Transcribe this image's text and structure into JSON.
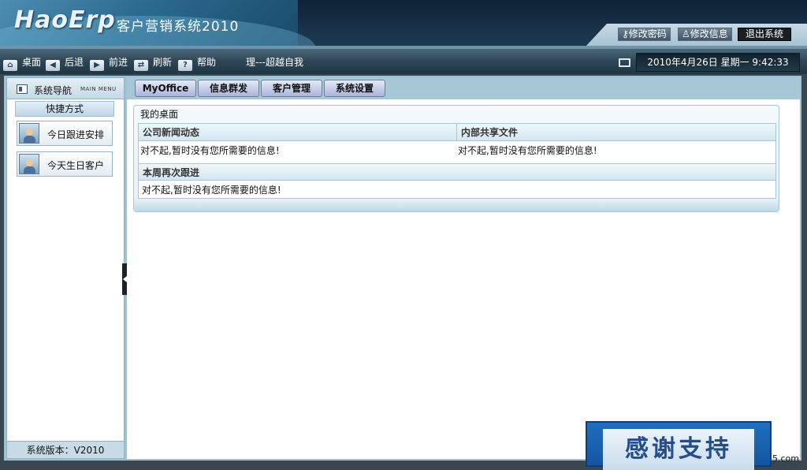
{
  "header": {
    "logo": "HaoErp",
    "app_title": "客户营销系统2010",
    "actions": {
      "change_password": "修改密码",
      "change_info": "修改信息",
      "logout": "退出系统"
    }
  },
  "toolbar": {
    "desktop": "桌面",
    "back": "后退",
    "forward": "前进",
    "refresh": "刷新",
    "help": "帮助",
    "help_icon": "?",
    "motto": "理---超越自我",
    "datetime": "2010年4月26日  星期一  9:42:33"
  },
  "sidebar": {
    "title": "系统导航",
    "subtitle": "MAIN MENU",
    "shortcut_header": "快捷方式",
    "shortcuts": [
      "今日跟进安排",
      "今天生日客户"
    ],
    "version": "系统版本：V2010"
  },
  "tabs": [
    "MyOffice",
    "信息群发",
    "客户管理",
    "系统设置"
  ],
  "desk": {
    "title": "我的桌面",
    "news_header": "公司新闻动态",
    "files_header": "内部共享文件",
    "followup_header": "本周再次跟进",
    "empty_message": "对不起,暂时没有您所需要的信息!"
  },
  "banner": {
    "text": "感谢支持",
    "watermark": "5.com"
  }
}
